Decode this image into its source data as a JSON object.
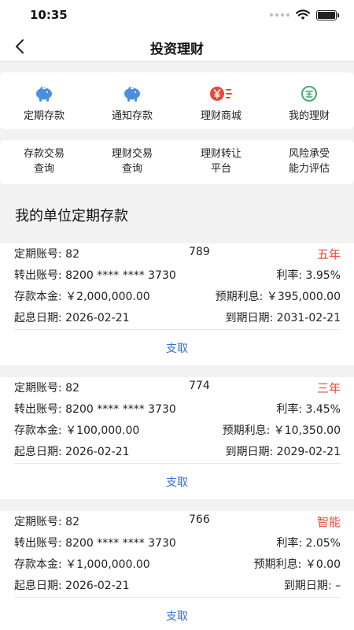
{
  "status_bar": {
    "time": "10:35",
    "icons": [
      "signal-dots-icon",
      "wifi-icon",
      "battery-icon"
    ]
  },
  "nav": {
    "title": "投资理财",
    "back_icon": "chevron-left-icon"
  },
  "menu": [
    {
      "label": "定期存款",
      "icon": "piggy-bank-icon",
      "color": "#4a8fe0"
    },
    {
      "label": "通知存款",
      "icon": "piggy-bank-icon",
      "color": "#4a8fe0"
    },
    {
      "label": "理财商城",
      "icon": "yen-coin-icon",
      "color": "#e5493b"
    },
    {
      "label": "我的理财",
      "icon": "wealth-circle-icon",
      "color": "#3fae6a"
    }
  ],
  "sub_menu": [
    {
      "line1": "存款交易",
      "line2": "查询"
    },
    {
      "line1": "理财交易",
      "line2": "查询"
    },
    {
      "line1": "理财转让",
      "line2": "平台"
    },
    {
      "line1": "风险承受",
      "line2": "能力评估"
    }
  ],
  "section_title": "我的单位定期存款",
  "deposits": [
    {
      "account_label": "定期账号: 82",
      "account_tail": "789",
      "term": "五年",
      "transfer_label": "转出账号: 8200 **** **** 3730",
      "rate": "利率: 3.95%",
      "principal": "存款本金: ￥2,000,000.00",
      "interest": "预期利息: ￥395,000.00",
      "start_date": "起息日期: 2026-02-21",
      "end_date": "到期日期: 2031-02-21",
      "action": "支取"
    },
    {
      "account_label": "定期账号: 82",
      "account_tail": "774",
      "term": "三年",
      "transfer_label": "转出账号: 8200 **** **** 3730",
      "rate": "利率: 3.45%",
      "principal": "存款本金: ￥100,000.00",
      "interest": "预期利息: ￥10,350.00",
      "start_date": "起息日期: 2026-02-21",
      "end_date": "到期日期: 2029-02-21",
      "action": "支取"
    },
    {
      "account_label": "定期账号: 82",
      "account_tail": "766",
      "term": "智能",
      "transfer_label": "转出账号: 8200 **** **** 3730",
      "rate": "利率: 2.05%",
      "principal": "存款本金: ￥1,000,000.00",
      "interest": "预期利息: ￥0.00",
      "start_date": "起息日期: 2026-02-21",
      "end_date": "到期日期: –",
      "action": "支取"
    }
  ],
  "colors": {
    "accent_blue": "#3a6fd6",
    "term_red": "#e5493b",
    "background": "#f2f2f2"
  }
}
